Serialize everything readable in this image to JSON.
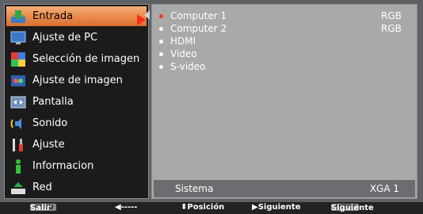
{
  "menu": {
    "items": [
      {
        "label": "Entrada",
        "icon": "input-icon",
        "active": true
      },
      {
        "label": "Ajuste de PC",
        "icon": "pc-monitor-icon"
      },
      {
        "label": "Selección de imagen",
        "icon": "image-select-icon"
      },
      {
        "label": "Ajuste de imagen",
        "icon": "image-adjust-icon"
      },
      {
        "label": "Pantalla",
        "icon": "screen-icon"
      },
      {
        "label": "Sonido",
        "icon": "speaker-icon"
      },
      {
        "label": "Ajuste",
        "icon": "tools-icon"
      },
      {
        "label": "Informacion",
        "icon": "info-icon"
      },
      {
        "label": "Red",
        "icon": "network-icon"
      }
    ]
  },
  "sources": [
    {
      "name": "Computer 1",
      "format": "RGB",
      "selected": true
    },
    {
      "name": "Computer 2",
      "format": "RGB",
      "selected": false
    },
    {
      "name": "HDMI",
      "format": "",
      "selected": false
    },
    {
      "name": "Video",
      "format": "",
      "selected": false
    },
    {
      "name": "S-video",
      "format": "",
      "selected": false
    }
  ],
  "system": {
    "label": "Sistema",
    "value": "XGA 1"
  },
  "help": {
    "menu_key": "MENU",
    "exit": "Salir",
    "back": "◀-----",
    "position": "⬍Posición",
    "next": "▶Siguiente",
    "enter_key": "ENTER",
    "enter_next": "Siguiente"
  },
  "colors": {
    "accent": "#ff2b1e",
    "active_item": "#e8894a",
    "panel": "#a9a9a9"
  }
}
